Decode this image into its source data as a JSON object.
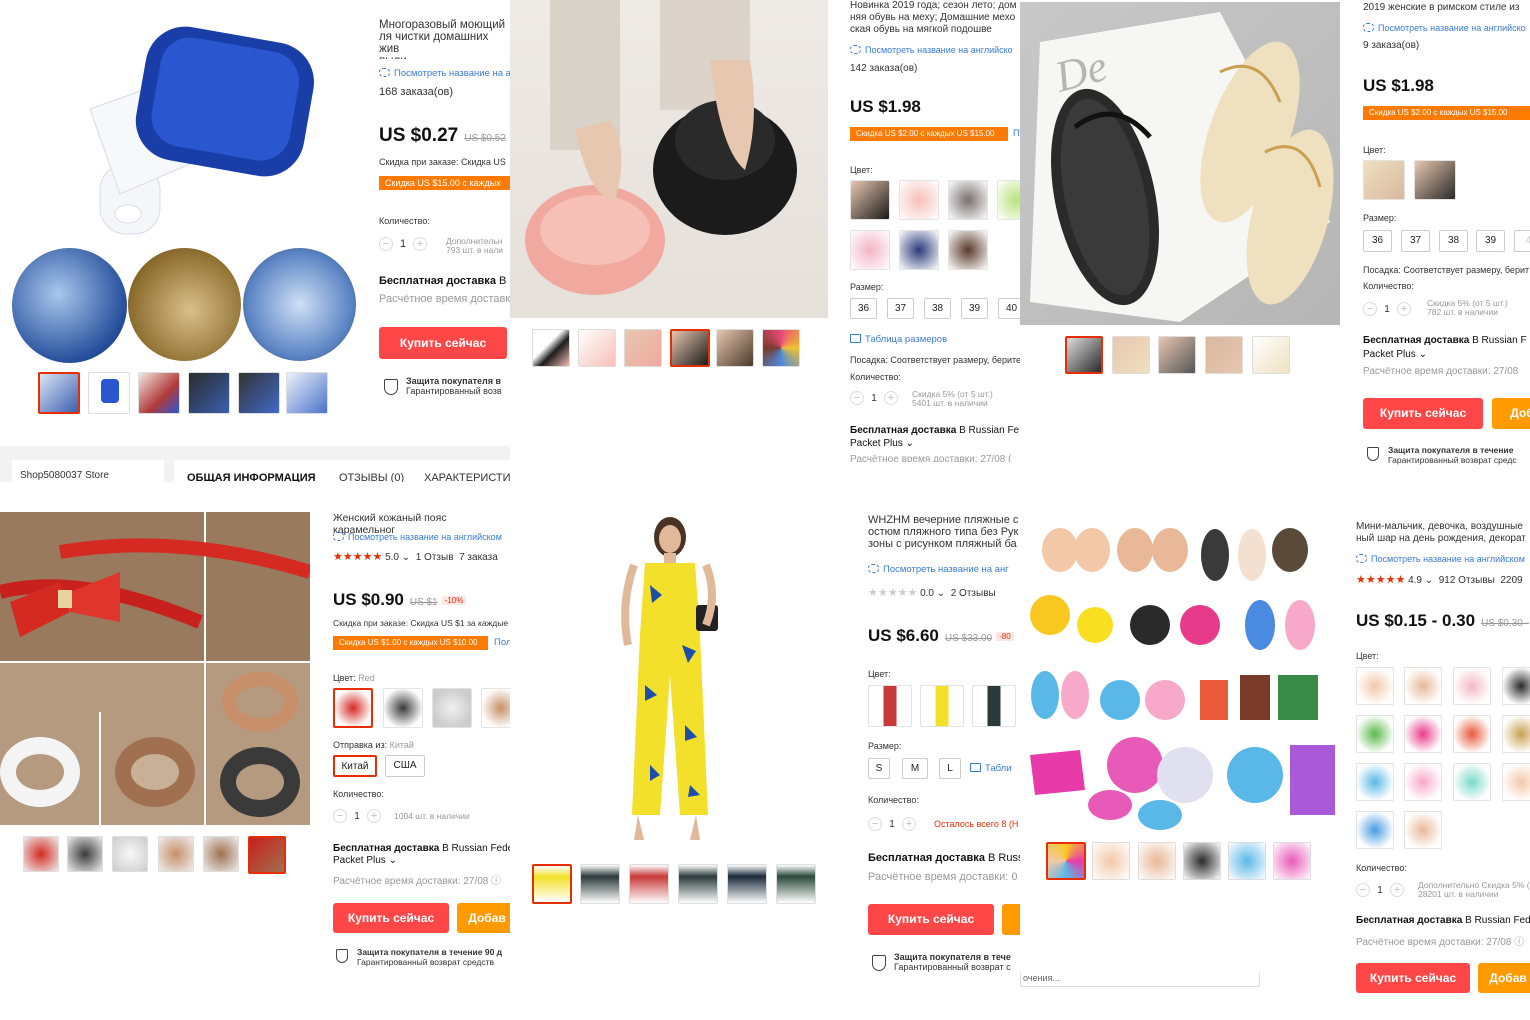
{
  "p1": {
    "title": "Многоразовый моющий\nля чистки домашних жив\nпыли",
    "translate": "Посмотреть название на ан",
    "orders": "168 заказа(ов)",
    "price": "US $0.27",
    "old_price": "US $0.52",
    "order_discount": "Скидка при заказе: Скидка US",
    "coupon": "Скидка US $15.00 с каждых",
    "qty_label": "Количество:",
    "qty": "1",
    "qty_extra": "Дополнительн\n793 шт. в нали",
    "shipping_bold": "Бесплатная доставка",
    "shipping_rest": " В",
    "eta": "Расчётное время доставк",
    "buy": "Купить сейчас",
    "protection_title": "Защита покупателя в",
    "protection_sub": "Гарантированный возв"
  },
  "p2": {},
  "p3": {
    "title": "Новинка 2019 года; сезон лето; дом\nняя обувь на меху; Домашние мехо\nская обувь на мягкой подошве",
    "translate": "Посмотреть название на английско",
    "orders": "142 заказа(ов)",
    "price": "US $1.98",
    "coupon": "Скидка US $2.00 с каждых US $15.00",
    "coupon_more": "П",
    "color_label": "Цвет:",
    "size_label": "Размер:",
    "sizes": [
      "36",
      "37",
      "38",
      "39",
      "40"
    ],
    "size_table": "Таблица размеров",
    "fit": "Посадка: Соответствует размеру, берите",
    "qty_label": "Количество:",
    "qty": "1",
    "qty_extra": "Скидка 5% (от 5 шт.)\n5401 шт. в наличии",
    "shipping_bold": "Бесплатная доставка",
    "shipping_rest": " В Russian Fe",
    "shipping_line2": "Packet Plus ⌄",
    "eta": "Расчётное время доставки: 27/08 ("
  },
  "p4": {},
  "p5": {
    "title": "2019 женские в римском стиле из",
    "translate": "Посмотреть название на английско",
    "orders": "9 заказа(ов)",
    "price": "US $1.98",
    "coupon": "Скидка US $2.00 с каждых US $15.00",
    "color_label": "Цвет:",
    "size_label": "Размер:",
    "sizes": [
      "36",
      "37",
      "38",
      "39",
      "4"
    ],
    "fit": "Посадка: Соответствует размеру, берит",
    "qty_label": "Количество:",
    "qty": "1",
    "qty_extra": "Скидка 5% (от 5 шт.)\n782 шт. в наличии",
    "shipping_bold": "Бесплатная доставка",
    "shipping_rest": " В Russian F",
    "shipping_line2": "Packet Plus ⌄",
    "eta": "Расчётное время доставки: 27/08",
    "buy": "Купить сейчас",
    "cart": "Доб",
    "protection_title": "Защита покупателя в течение",
    "protection_sub": "Гарантированный возврат средс"
  },
  "p6": {
    "store": "Shop5080037 Store",
    "tabs": [
      "ОБЩАЯ ИНФОРМАЦИЯ",
      "ОТЗЫВЫ (0)",
      "ХАРАКТЕРИСТИК"
    ]
  },
  "p7": {
    "title": "Женский кожаный пояс карамельног",
    "translate": "Посмотреть название на английском",
    "stars": "★★★★★",
    "rating": "5.0 ⌄",
    "reviews": "1 Отзыв",
    "orders": "7 заказа",
    "price": "US $0.90",
    "old_price": "US $1",
    "discount": "-10%",
    "order_discount": "Скидка при заказе: Скидка US $1 за каждые",
    "coupon": "Скидка US $1.00 с каждых US $10.00",
    "coupon_more": "Пол",
    "color_label": "Цвет:",
    "color_value": "Red",
    "ship_from_label": "Отправка из:",
    "ship_from_value": "Китай",
    "origins": [
      "Китай",
      "США"
    ],
    "qty_label": "Количество:",
    "qty": "1",
    "qty_extra": "1004 шт. в наличии",
    "shipping_bold": "Бесплатная доставка",
    "shipping_rest": " В Russian Fede",
    "shipping_line2": "Packet Plus ⌄",
    "eta": "Расчётное время доставки: 27/08 ⓘ",
    "buy": "Купить сейчас",
    "cart": "Добав",
    "protection_title": "Защита покупателя в течение 90 д",
    "protection_sub": "Гарантированный возврат средств"
  },
  "p8": {},
  "p9": {
    "title": "WHZHM вечерние пляжные с\nостюм пляжного типа без Рук\nзоны с рисунком пляжный ба",
    "translate": "Посмотреть название на анг",
    "stars": "★★★★★",
    "rating": "0.0 ⌄",
    "reviews": "2 Отзывы",
    "price": "US $6.60",
    "old_price": "US $33.00",
    "discount": "-80",
    "color_label": "Цвет:",
    "size_label": "Размер:",
    "sizes": [
      "S",
      "M",
      "L"
    ],
    "size_table": "Табли",
    "qty_label": "Количество:",
    "qty": "1",
    "qty_extra": "Осталось всего 8 (Н",
    "shipping_bold": "Бесплатная доставка",
    "shipping_rest": " В Russ",
    "eta": "Расчётное время доставки: 0",
    "buy": "Купить сейчас",
    "protection_title": "Защита покупателя в тече",
    "protection_sub": "Гарантированный возврат с"
  },
  "p10": {
    "search_fragment": "очения..."
  },
  "p11": {
    "title": "Мини-мальчик, девочка, воздушные\nный шар на день рождения, декорат",
    "translate": "Посмотреть название на английском",
    "stars": "★★★★★",
    "rating": "4.9 ⌄",
    "reviews": "912 Отзывы",
    "orders": "2209",
    "price": "US $0.15 - 0.30",
    "old_price": "US $0.30 -",
    "color_label": "Цвет:",
    "qty_label": "Количество:",
    "qty": "1",
    "qty_extra": "Дополнительно Скидка 5% (\n28201 шт. в наличии",
    "shipping_bold": "Бесплатная доставка",
    "shipping_rest": " В Russian Fede",
    "eta": "Расчётное время доставки: 27/08 ⓘ",
    "buy": "Купить сейчас",
    "cart": "Добав"
  },
  "colors": {
    "accent_red": "#ff4747",
    "orange": "#ff9a00",
    "coupon_orange": "#ff7a00",
    "link_blue": "#3a7bd5"
  },
  "icons": [
    "translate-icon",
    "shield-check-icon",
    "size-table-icon",
    "star-icon",
    "info-icon"
  ]
}
